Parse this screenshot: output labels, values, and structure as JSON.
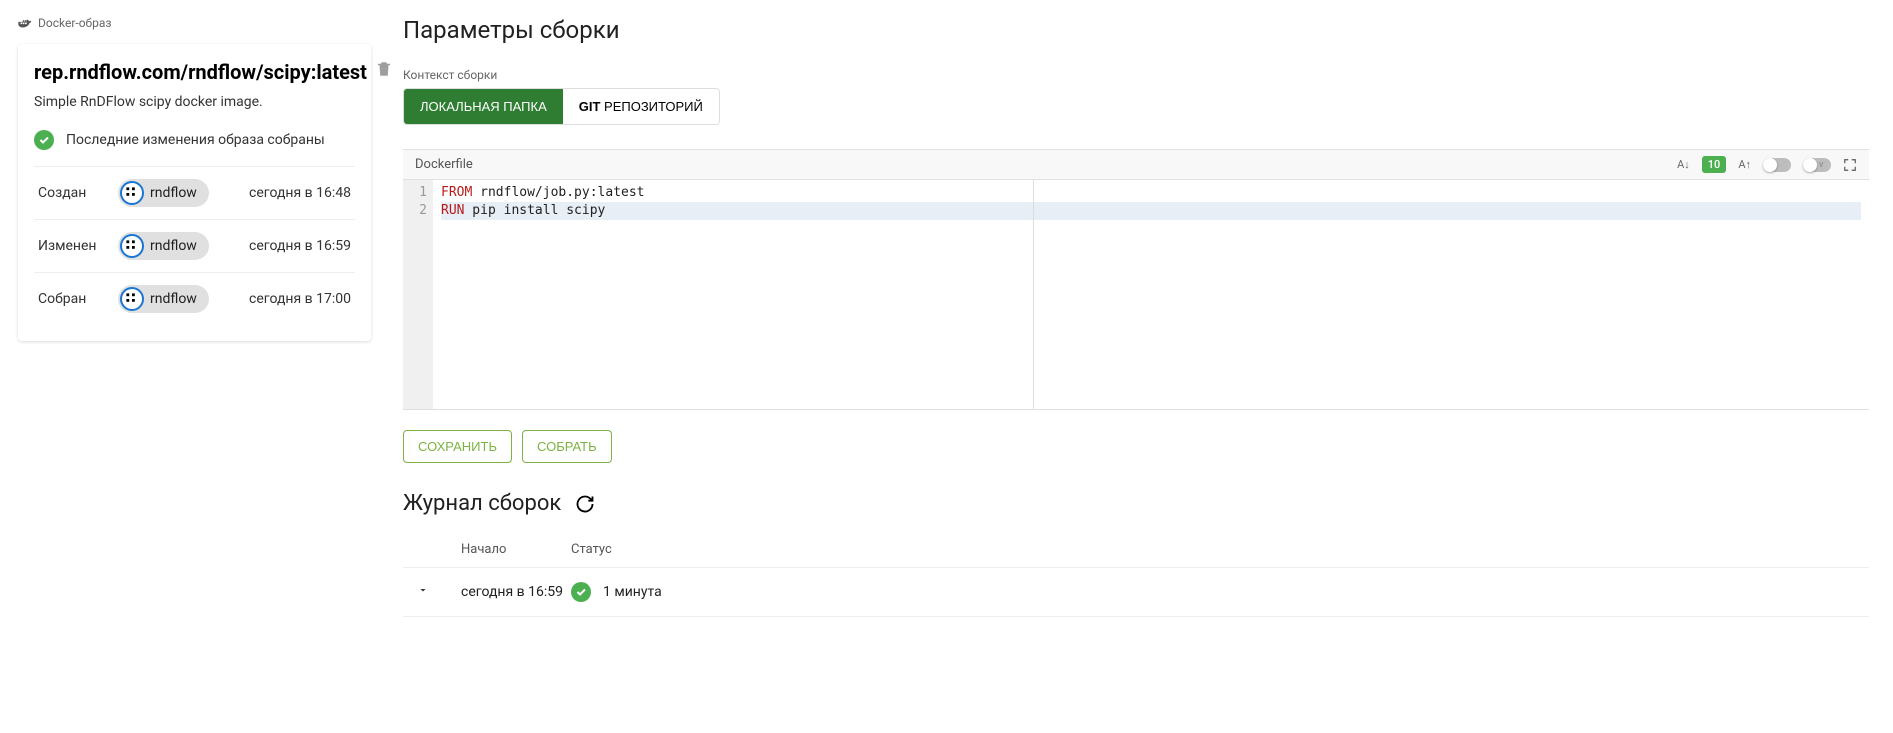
{
  "breadcrumb": {
    "label": "Docker-образ"
  },
  "sidebar": {
    "imageName": "rep.rndflow.com/rndflow/scipy:latest",
    "description": "Simple RnDFlow scipy docker image.",
    "statusText": "Последние изменения образа собраны",
    "rows": [
      {
        "label": "Создан",
        "user": "rndflow",
        "time": "сегодня в 16:48"
      },
      {
        "label": "Изменен",
        "user": "rndflow",
        "time": "сегодня в 16:59"
      },
      {
        "label": "Собран",
        "user": "rndflow",
        "time": "сегодня в 17:00"
      }
    ]
  },
  "main": {
    "buildParamsTitle": "Параметры сборки",
    "contextLabel": "Контекст сборки",
    "tabs": {
      "local": "ЛОКАЛЬНАЯ ПАПКА",
      "gitBold": "GIT",
      "gitRest": " РЕПОЗИТОРИЙ"
    },
    "editor": {
      "title": "Dockerfile",
      "fontDownLabel": "A↓",
      "fontSize": "10",
      "fontUpLabel": "A↑",
      "toggleVLabel": "v",
      "lines": [
        {
          "num": "1",
          "kw": "FROM",
          "rest": " rndflow/job.py:latest"
        },
        {
          "num": "2",
          "kw": "RUN",
          "rest": " pip install scipy"
        }
      ]
    },
    "buttons": {
      "save": "СОХРАНИТЬ",
      "build": "СОБРАТЬ"
    },
    "log": {
      "title": "Журнал сборок",
      "headers": {
        "start": "Начало",
        "status": "Статус"
      },
      "entries": [
        {
          "start": "сегодня в 16:59",
          "duration": "1 минута"
        }
      ]
    }
  }
}
